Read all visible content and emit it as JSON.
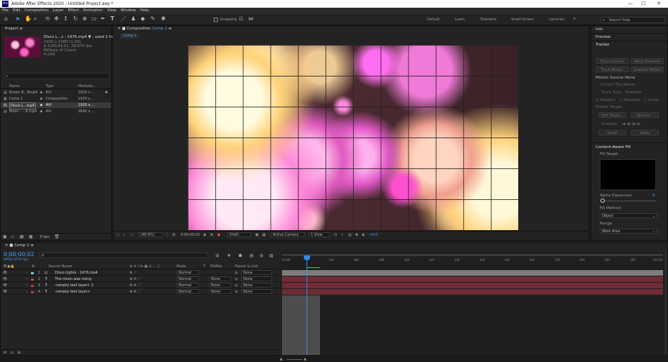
{
  "window": {
    "title": "Adobe After Effects 2020 - Untitled Project.aep *",
    "minimize": "—",
    "maximize": "☐",
    "close": "✕"
  },
  "menu": [
    "File",
    "Edit",
    "Composition",
    "Layer",
    "Effect",
    "Animation",
    "View",
    "Window",
    "Help"
  ],
  "toolbar": {
    "snapping_label": "Snapping",
    "workspaces": [
      "Default",
      "Learn",
      "Standard",
      "Small Screen",
      "Libraries"
    ],
    "search_placeholder": "Search Help"
  },
  "project": {
    "tab": "Project",
    "footage_name": "Disco L...s - 1476.mp4 ▼ , used 1 time",
    "footage_info": [
      "1920 x 1080 (1.00)",
      "Δ 0;00;04;01, 29.970 fps",
      "Millions of Colors",
      "H.264"
    ],
    "columns": [
      "Name",
      "Type",
      "Media Dur",
      "Size"
    ],
    "columns_vis": [
      "Name",
      "Type",
      "Mediadu..."
    ],
    "items": [
      {
        "name": "Brown B...Bmp4",
        "type": "AVI",
        "size": "1920 x ..."
      },
      {
        "name": "Comp 1",
        "type": "Composition",
        "size": "1920 x ..."
      },
      {
        "name": "Disco L...mp4",
        "type": "AVI",
        "size": "1920 x ..."
      },
      {
        "name": "Moon - ...6.mp4",
        "type": "AVI",
        "size": "3840 x ..."
      }
    ],
    "bpc": "8 bpc"
  },
  "composition": {
    "tab": "Composition",
    "tab_comp": "Comp 1",
    "flow_tab": "Comp 1",
    "zoom": "(49.4%)",
    "timecode": "0;00;00;02",
    "resolution": "(Half)",
    "camera": "Active Camera",
    "views": "1 View",
    "exposure": "+0.0"
  },
  "right": {
    "info": "Info",
    "preview": "Preview",
    "tracker": {
      "title": "Tracker",
      "buttons": [
        "Track Camera",
        "Warp Stabilizer",
        "Track Motion",
        "Stabilize Motion"
      ],
      "motion_source_label": "Motion Source:",
      "motion_source_value": "None",
      "current_track_label": "Current Track:",
      "current_track_value": "None",
      "track_type_label": "Track Type:",
      "track_type_value": "Stabilize",
      "checks": [
        "Position",
        "Rotation",
        "Scale"
      ],
      "motion_target": "Motion Target:",
      "btn_edit": "Edit Target...",
      "btn_options": "Options...",
      "analyze": "Analyze:",
      "btn_reset": "Reset",
      "btn_apply": "Apply"
    },
    "caf": {
      "title": "Content-Aware Fill",
      "fill_target": "Fill Target",
      "alpha_expansion": "Alpha Expansion",
      "alpha_value": "0",
      "alpha_fraction": 0,
      "fill_method_label": "Fill Method",
      "fill_method": "Object",
      "range_label": "Range",
      "range": "Work Area"
    }
  },
  "timeline": {
    "tab": "Comp 1",
    "timecode": "0;00;00;02",
    "timecode_sub": "00002 (29.97 fps)",
    "search_placeholder": "ρ",
    "columns": [
      "#",
      "Source Name",
      "Mode",
      "T",
      "TrkMat",
      "Parent & Link"
    ],
    "layers": [
      {
        "num": "1",
        "name": "Disco Lights - 1476.mp4",
        "type": "video",
        "color": "#8cc6d6",
        "mode": "Normal",
        "trkmat": "",
        "parent": "None"
      },
      {
        "num": "2",
        "name": "The moon was rising",
        "type": "text",
        "color": "#c63d3d",
        "mode": "Normal",
        "trkmat": "None",
        "parent": "None"
      },
      {
        "num": "3",
        "name": "<empty text layer> 2",
        "type": "text",
        "color": "#c63d3d",
        "mode": "Normal",
        "trkmat": "None",
        "parent": "None"
      },
      {
        "num": "4",
        "name": "<empty text layer>",
        "type": "text",
        "color": "#c63d3d",
        "mode": "Normal",
        "trkmat": "None",
        "parent": "None"
      }
    ],
    "ruler": [
      "0:00f",
      "02f",
      "04f",
      "06f",
      "08f",
      "10f",
      "12f",
      "14f",
      "16f",
      "18f",
      "20f",
      "22f",
      "24f",
      "26f",
      "28f",
      "01:00"
    ],
    "toggle_label": "Toggle Switches / Modes"
  },
  "colors": {
    "accent": "#2d8ceb",
    "purple_layer": "#6e2c36",
    "clip": "#4d4d4d"
  }
}
